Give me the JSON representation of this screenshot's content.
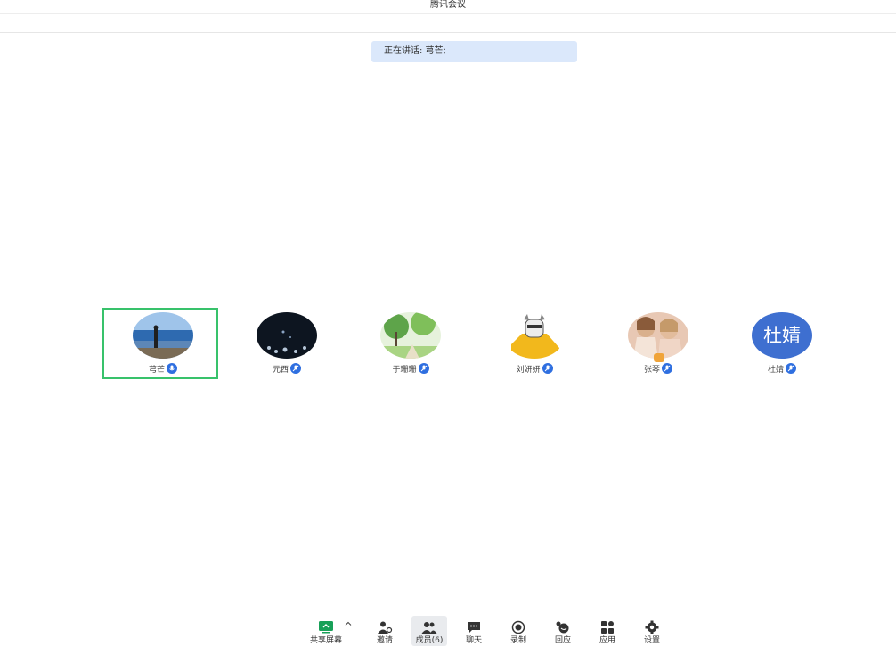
{
  "window": {
    "title": "腾讯会议"
  },
  "speaking": {
    "text": "正在讲话: 芎芒;"
  },
  "participants": [
    {
      "name": "芎芒",
      "avatar_icon": "photo-lakeside-person-icon",
      "mic_state": "mic-on"
    },
    {
      "name": "元西",
      "avatar_icon": "photo-dark-bubbles-icon",
      "mic_state": "mic-off"
    },
    {
      "name": "于珊珊",
      "avatar_icon": "photo-trees-icon",
      "mic_state": "mic-off"
    },
    {
      "name": "刘妍妍",
      "avatar_icon": "photo-cartoon-cat-icon",
      "mic_state": "mic-off"
    },
    {
      "name": "张琴",
      "avatar_icon": "photo-two-girls-icon",
      "mic_state": "mic-off",
      "has_role_badge": true
    },
    {
      "name": "杜婧",
      "avatar_text": "杜婧",
      "mic_state": "mic-off"
    }
  ],
  "toolbar": {
    "share": "共享屏幕",
    "invite": "邀请",
    "members": "成员(6)",
    "chat": "聊天",
    "record": "录制",
    "reactions": "回应",
    "apps": "应用",
    "settings": "设置"
  },
  "colors": {
    "accent": "#2f6fe0",
    "active_border": "#38c26b",
    "speaking_bg": "#dbe8fb",
    "text_avatar_bg": "#3e6fd0",
    "share_icon": "#18a058"
  }
}
